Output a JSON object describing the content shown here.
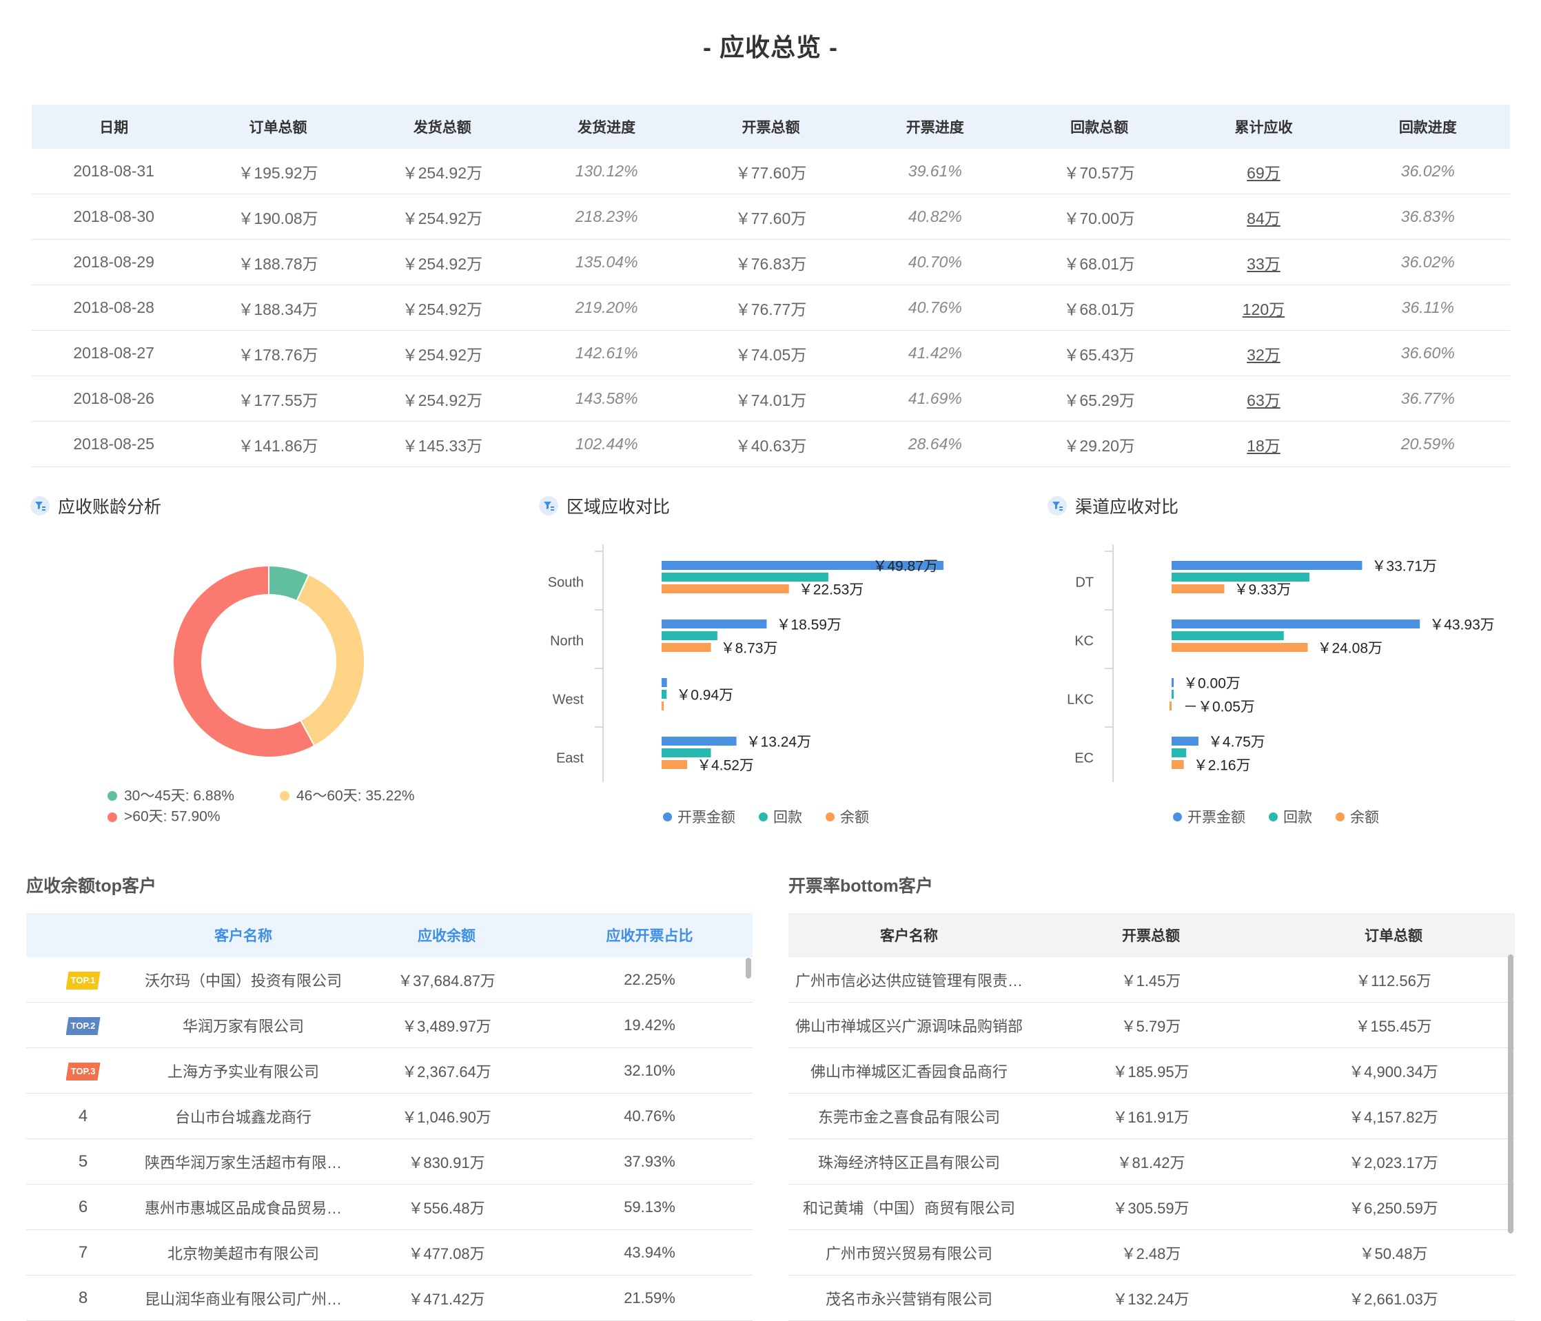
{
  "page_title": "- 应收总览 -",
  "overview": {
    "headers": [
      "日期",
      "订单总额",
      "发货总额",
      "发货进度",
      "开票总额",
      "开票进度",
      "回款总额",
      "累计应收",
      "回款进度"
    ],
    "rows": [
      [
        "2018-08-31",
        "￥195.92万",
        "￥254.92万",
        "130.12%",
        "￥77.60万",
        "39.61%",
        "￥70.57万",
        "69万",
        "36.02%"
      ],
      [
        "2018-08-30",
        "￥190.08万",
        "￥254.92万",
        "218.23%",
        "￥77.60万",
        "40.82%",
        "￥70.00万",
        "84万",
        "36.83%"
      ],
      [
        "2018-08-29",
        "￥188.78万",
        "￥254.92万",
        "135.04%",
        "￥76.83万",
        "40.70%",
        "￥68.01万",
        "33万",
        "36.02%"
      ],
      [
        "2018-08-28",
        "￥188.34万",
        "￥254.92万",
        "219.20%",
        "￥76.77万",
        "40.76%",
        "￥68.01万",
        "120万",
        "36.11%"
      ],
      [
        "2018-08-27",
        "￥178.76万",
        "￥254.92万",
        "142.61%",
        "￥74.05万",
        "41.42%",
        "￥65.43万",
        "32万",
        "36.60%"
      ],
      [
        "2018-08-26",
        "￥177.55万",
        "￥254.92万",
        "143.58%",
        "￥74.01万",
        "41.69%",
        "￥65.29万",
        "63万",
        "36.77%"
      ],
      [
        "2018-08-25",
        "￥141.86万",
        "￥145.33万",
        "102.44%",
        "￥40.63万",
        "28.64%",
        "￥29.20万",
        "18万",
        "20.59%"
      ]
    ]
  },
  "aging": {
    "title": "应收账龄分析",
    "legend": [
      {
        "label": "30～45天: 6.88%",
        "color": "#5fbf9f"
      },
      {
        "label": "46～60天: 35.22%",
        "color": "#fdd386"
      },
      {
        "label": ">60天: 57.90%",
        "color": "#fb7a6f"
      }
    ]
  },
  "region": {
    "title": "区域应收对比"
  },
  "channel": {
    "title": "渠道应收对比"
  },
  "legend_bars": [
    "开票金额",
    "回款",
    "余额"
  ],
  "chart_data": [
    {
      "type": "pie",
      "title": "应收账龄分析",
      "labels": [
        "30～45天",
        "46～60天",
        ">60天"
      ],
      "values": [
        6.88,
        35.22,
        57.9
      ],
      "colors": [
        "#5fbf9f",
        "#fdd386",
        "#fb7a6f"
      ]
    },
    {
      "type": "bar",
      "title": "区域应收对比",
      "orientation": "horizontal",
      "categories": [
        "South",
        "North",
        "West",
        "East"
      ],
      "series": [
        {
          "name": "开票金额",
          "color": "#4a90e2",
          "values": [
            49.87,
            18.59,
            0.94,
            13.24
          ]
        },
        {
          "name": "回款",
          "color": "#27b8b0",
          "values": [
            29.5,
            9.86,
            0.89,
            8.72
          ]
        },
        {
          "name": "余额",
          "color": "#fb9e52",
          "values": [
            22.53,
            8.73,
            0.05,
            4.52
          ]
        }
      ],
      "labels": [
        {
          "category": "South",
          "series": "开票金额",
          "text": "￥49.87万"
        },
        {
          "category": "South",
          "series": "余额",
          "text": "￥22.53万"
        },
        {
          "category": "North",
          "series": "开票金额",
          "text": "￥18.59万"
        },
        {
          "category": "North",
          "series": "余额",
          "text": "￥8.73万"
        },
        {
          "category": "West",
          "series": "回款",
          "text": "￥0.94万"
        },
        {
          "category": "East",
          "series": "开票金额",
          "text": "￥13.24万"
        },
        {
          "category": "East",
          "series": "余额",
          "text": "￥4.52万"
        }
      ]
    },
    {
      "type": "bar",
      "title": "渠道应收对比",
      "orientation": "horizontal",
      "categories": [
        "DT",
        "KC",
        "LKC",
        "EC"
      ],
      "series": [
        {
          "name": "开票金额",
          "color": "#4a90e2",
          "values": [
            33.71,
            43.93,
            0.0,
            4.75
          ]
        },
        {
          "name": "回款",
          "color": "#27b8b0",
          "values": [
            24.38,
            19.85,
            0.0,
            2.59
          ]
        },
        {
          "name": "余额",
          "color": "#fb9e52",
          "values": [
            9.33,
            24.08,
            -0.05,
            2.16
          ]
        }
      ],
      "labels": [
        {
          "category": "DT",
          "series": "开票金额",
          "text": "￥33.71万"
        },
        {
          "category": "DT",
          "series": "余额",
          "text": "￥9.33万"
        },
        {
          "category": "KC",
          "series": "开票金额",
          "text": "￥43.93万"
        },
        {
          "category": "KC",
          "series": "余额",
          "text": "￥24.08万"
        },
        {
          "category": "LKC",
          "series": "开票金额",
          "text": "￥0.00万"
        },
        {
          "category": "LKC",
          "series": "余额",
          "text": "－￥0.05万"
        },
        {
          "category": "EC",
          "series": "开票金额",
          "text": "￥4.75万"
        },
        {
          "category": "EC",
          "series": "余额",
          "text": "￥2.16万"
        }
      ]
    }
  ],
  "top_customers": {
    "title": "应收余额top客户",
    "headers": [
      "",
      "客户名称",
      "应收余额",
      "应收开票占比"
    ],
    "rows": [
      {
        "rank": "TOP.1",
        "badge_color": "#f5c518",
        "name": "沃尔玛（中国）投资有限公司",
        "balance": "￥37,684.87万",
        "ratio": "22.25%"
      },
      {
        "rank": "TOP.2",
        "badge_color": "#5b86c4",
        "name": "华润万家有限公司",
        "balance": "￥3,489.97万",
        "ratio": "19.42%"
      },
      {
        "rank": "TOP.3",
        "badge_color": "#f0734d",
        "name": "上海方予实业有限公司",
        "balance": "￥2,367.64万",
        "ratio": "32.10%"
      },
      {
        "rank": "4",
        "name": "台山市台城鑫龙商行",
        "balance": "￥1,046.90万",
        "ratio": "40.76%"
      },
      {
        "rank": "5",
        "name": "陕西华润万家生活超市有限…",
        "balance": "￥830.91万",
        "ratio": "37.93%"
      },
      {
        "rank": "6",
        "name": "惠州市惠城区品成食品贸易…",
        "balance": "￥556.48万",
        "ratio": "59.13%"
      },
      {
        "rank": "7",
        "name": "北京物美超市有限公司",
        "balance": "￥477.08万",
        "ratio": "43.94%"
      },
      {
        "rank": "8",
        "name": "昆山润华商业有限公司广州…",
        "balance": "￥471.42万",
        "ratio": "21.59%"
      }
    ]
  },
  "bottom_customers": {
    "title": "开票率bottom客户",
    "headers": [
      "客户名称",
      "开票总额",
      "订单总额"
    ],
    "rows": [
      [
        "广州市信必达供应链管理有限责…",
        "￥1.45万",
        "￥112.56万"
      ],
      [
        "佛山市禅城区兴广源调味品购销部",
        "￥5.79万",
        "￥155.45万"
      ],
      [
        "佛山市禅城区汇香园食品商行",
        "￥185.95万",
        "￥4,900.34万"
      ],
      [
        "东莞市金之喜食品有限公司",
        "￥161.91万",
        "￥4,157.82万"
      ],
      [
        "珠海经济特区正昌有限公司",
        "￥81.42万",
        "￥2,023.17万"
      ],
      [
        "和记黄埔（中国）商贸有限公司",
        "￥305.59万",
        "￥6,250.59万"
      ],
      [
        "广州市贸兴贸易有限公司",
        "￥2.48万",
        "￥50.48万"
      ],
      [
        "茂名市永兴营销有限公司",
        "￥132.24万",
        "￥2,661.03万"
      ]
    ]
  }
}
